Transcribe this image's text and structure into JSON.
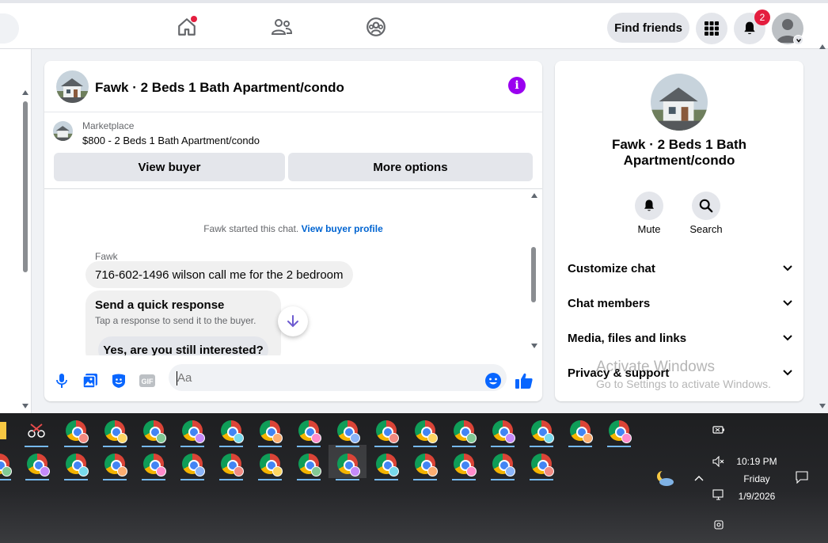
{
  "topbar": {
    "find_friends_label": "Find friends",
    "notification_count": "2",
    "home_has_dot": true
  },
  "chat": {
    "title": "Fawk · 2 Beds 1 Bath Apartment/condo",
    "marketplace": {
      "source": "Marketplace",
      "listing": "$800 - 2 Beds 1 Bath Apartment/condo"
    },
    "buttons": {
      "view_buyer": "View buyer",
      "more_options": "More options"
    },
    "started_text": "Fawk started this chat.",
    "view_buyer_profile": "View buyer profile",
    "sender": "Fawk",
    "message": "716-602-1496  wilson call me for the 2 bedroom",
    "quick_response": {
      "title": "Send a quick response",
      "subtitle": "Tap a response to send it to the buyer.",
      "option": "Yes, are you still interested?"
    },
    "composer_placeholder": "Aa"
  },
  "info_panel": {
    "name": "Fawk · 2 Beds 1 Bath Apartment/condo",
    "actions": [
      {
        "label": "Mute",
        "icon": "bell-icon"
      },
      {
        "label": "Search",
        "icon": "search-icon"
      }
    ],
    "sections": [
      "Customize chat",
      "Chat members",
      "Media, files and links",
      "Privacy & support"
    ]
  },
  "watermark": {
    "line1": "Activate Windows",
    "line2": "Go to Settings to activate Windows."
  },
  "taskbar": {
    "time": "10:19 PM",
    "day": "Friday",
    "date": "1/9/2026"
  },
  "colors": {
    "accent": "#0866ff",
    "info_purple": "#9a00f0",
    "badge_red": "#e41e3f",
    "taskbar_line": "#76b9ed"
  }
}
